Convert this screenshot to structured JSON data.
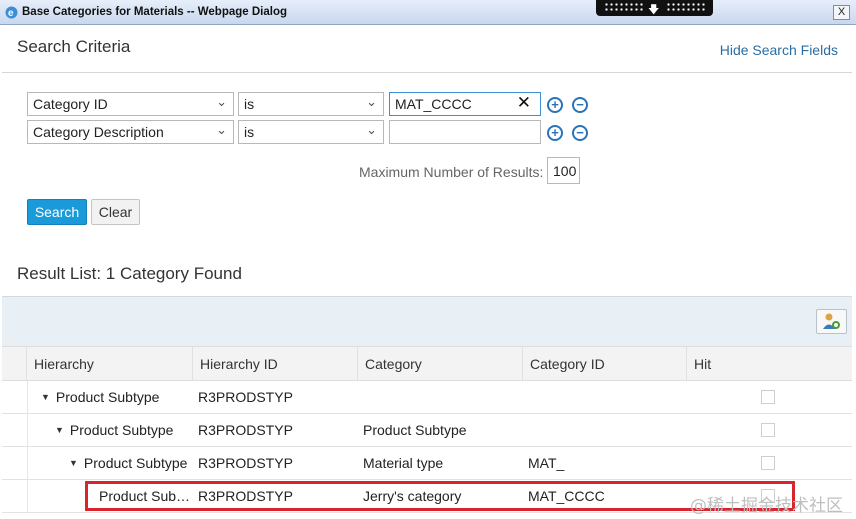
{
  "window": {
    "title": "Base Categories for Materials -- Webpage Dialog",
    "close": "X"
  },
  "header": {
    "title": "Search Criteria",
    "hide_link": "Hide Search Fields"
  },
  "criteria": [
    {
      "field": "Category ID",
      "operator": "is",
      "value": "MAT_CCCC"
    },
    {
      "field": "Category Description",
      "operator": "is",
      "value": ""
    }
  ],
  "max_results": {
    "label": "Maximum Number of Results:",
    "value": "100"
  },
  "buttons": {
    "search": "Search",
    "clear": "Clear"
  },
  "result_title": "Result List: 1 Category Found",
  "table": {
    "columns": [
      "Hierarchy",
      "Hierarchy ID",
      "Category",
      "Category ID",
      "Hit"
    ],
    "rows": [
      {
        "hierarchy": "Product Subtype",
        "hierarchy_id": "R3PRODSTYP",
        "category": "",
        "category_id": "",
        "level": 0,
        "expanded": true
      },
      {
        "hierarchy": "Product Subtype",
        "hierarchy_id": "R3PRODSTYP",
        "category": "Product Subtype",
        "category_id": "",
        "level": 1,
        "expanded": true
      },
      {
        "hierarchy": "Product Subtype",
        "hierarchy_id": "R3PRODSTYP",
        "category": "Material type",
        "category_id": "MAT_",
        "level": 2,
        "expanded": true
      },
      {
        "hierarchy": "Product Sub…",
        "hierarchy_id": "R3PRODSTYP",
        "category": "Jerry's category",
        "category_id": "MAT_CCCC",
        "level": 3,
        "expanded": false
      }
    ]
  },
  "watermark": "@稀土掘金技术社区",
  "colors": {
    "accent": "#1a9ad8",
    "highlight": "#d9232d",
    "link": "#2a6ea6"
  }
}
